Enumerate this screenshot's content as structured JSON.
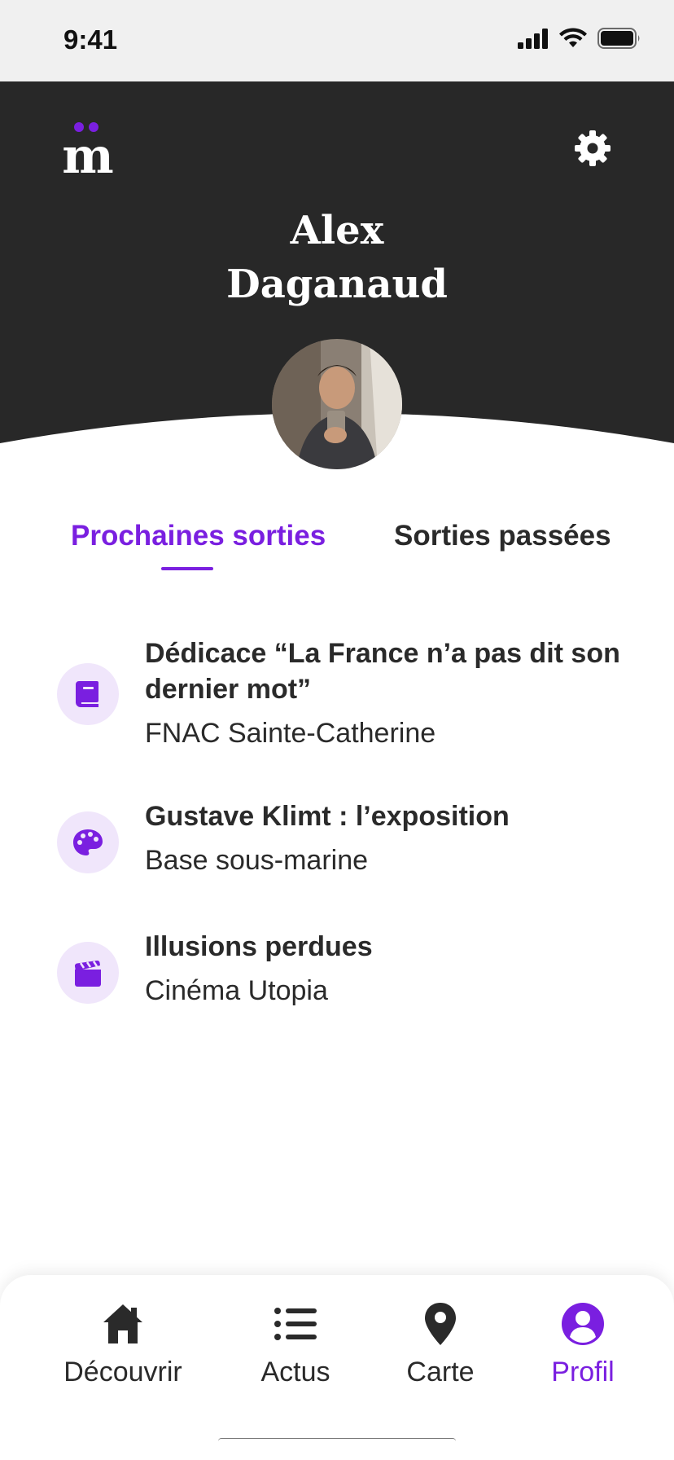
{
  "status_bar": {
    "time": "9:41"
  },
  "header": {
    "logo_text": "m",
    "profile_name_line1": "Alex",
    "profile_name_line2": "Daganaud"
  },
  "tabs": [
    {
      "label": "Prochaines sorties",
      "active": true
    },
    {
      "label": "Sorties passées",
      "active": false
    }
  ],
  "events": [
    {
      "icon": "book-icon",
      "title": "Dédicace “La France n’a pas dit son dernier mot”",
      "venue": "FNAC Sainte-Catherine"
    },
    {
      "icon": "palette-icon",
      "title": "Gustave Klimt : l’exposition",
      "venue": "Base sous-marine"
    },
    {
      "icon": "clapperboard-icon",
      "title": "Illusions perdues",
      "venue": "Cinéma Utopia"
    }
  ],
  "nav": [
    {
      "icon": "home-icon",
      "label": "Découvrir",
      "active": false
    },
    {
      "icon": "list-icon",
      "label": "Actus",
      "active": false
    },
    {
      "icon": "map-pin-icon",
      "label": "Carte",
      "active": false
    },
    {
      "icon": "user-icon",
      "label": "Profil",
      "active": true
    }
  ],
  "colors": {
    "accent": "#7a1fe0",
    "header_bg": "#282828",
    "icon_bg": "#f0e6fb",
    "text": "#2a2a2a"
  }
}
